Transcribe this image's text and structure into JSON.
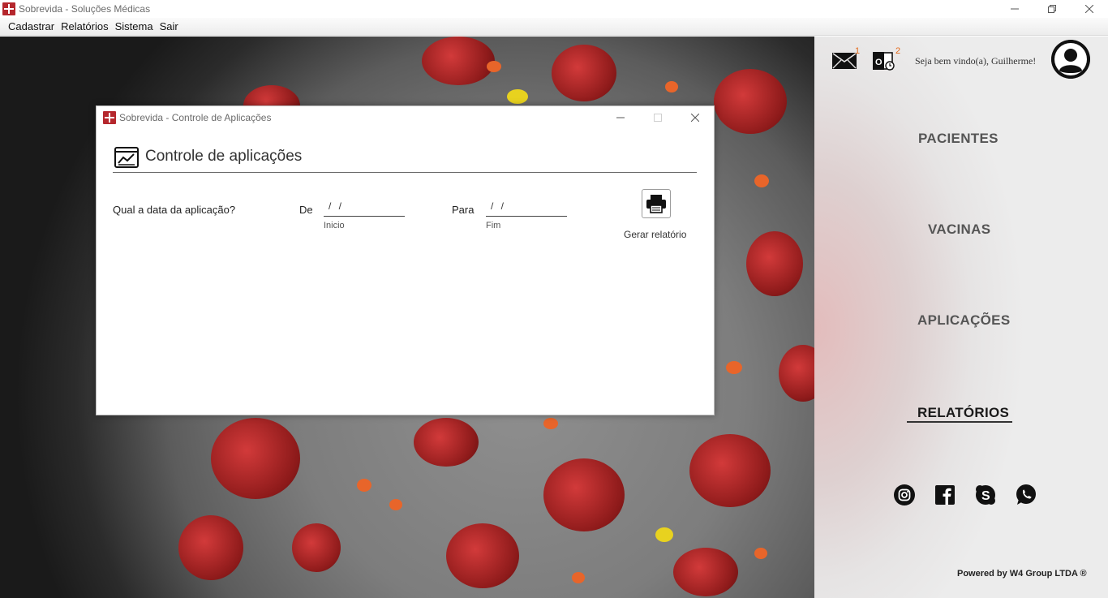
{
  "window": {
    "title": "Sobrevida - Soluções Médicas"
  },
  "menu": {
    "items": [
      "Cadastrar",
      "Relatórios",
      "Sistema",
      "Sair"
    ]
  },
  "header": {
    "mail_badge": "1",
    "outlook_badge": "2",
    "welcome": "Seja bem vindo(a), Guilherme!"
  },
  "nav": {
    "items": [
      "PACIENTES",
      "VACINAS",
      "APLICAÇÕES",
      "RELATÓRIOS"
    ],
    "active": "RELATÓRIOS"
  },
  "social": [
    "instagram-icon",
    "facebook-icon",
    "skype-icon",
    "whatsapp-icon"
  ],
  "footer": {
    "powered": "Powered by W4 Group LTDA ®"
  },
  "dialog": {
    "title": "Sobrevida - Controle de Aplicações",
    "heading": "Controle de aplicações",
    "question": "Qual a data da aplicação?",
    "from_label": "De",
    "from_value": "/ /",
    "from_hint": "Inicio",
    "to_label": "Para",
    "to_value": "/ /",
    "to_hint": "Fim",
    "print_label": "Gerar relatório"
  },
  "colors": {
    "brand": "#b5272d",
    "badge": "#e46a1a"
  }
}
